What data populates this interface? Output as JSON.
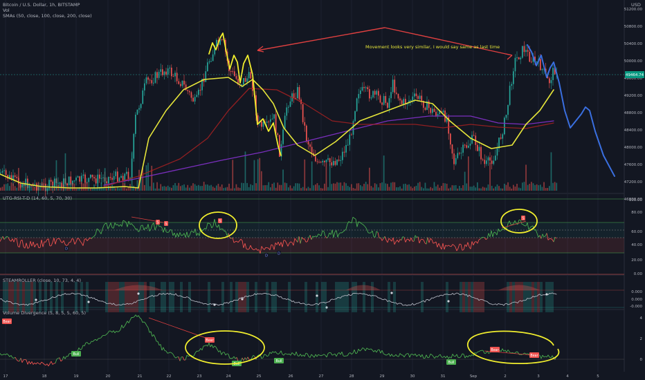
{
  "symbol_title": "Bitcoin / U.S. Dollar, 1h, BITSTAMP",
  "vol_label": "Vol",
  "sma_label": "SMAs (50, close, 100, close, 200, close)",
  "currency": "USD",
  "annotation": "Movement looks very similar, I would say same as last time",
  "price_badge": "49464.74",
  "price_axis": [
    "51200.00",
    "50800.00",
    "50400.00",
    "50000.00",
    "49600.00",
    "49200.00",
    "48800.00",
    "48400.00",
    "48000.00",
    "47600.00",
    "47200.00",
    "46800.00"
  ],
  "rsi": {
    "label": "UTG-RSI-T-D (14, 60, 5, 70, 30)",
    "axis": [
      "100.00",
      "80.00",
      "60.00",
      "40.00",
      "20.00",
      "0.00"
    ],
    "markers": [
      "S",
      "S",
      "S",
      "D",
      "D",
      "D",
      "S"
    ]
  },
  "steam": {
    "label": "STEAMROLLER (close, 10, 73, 4, 4)",
    "axis": [
      "0.000",
      "0.000",
      "-0.000"
    ]
  },
  "vdiv": {
    "label": "Volume Divergence (5, 8, 5, 5, 60, 5)",
    "axis": [
      "4",
      "2",
      "0"
    ],
    "bull_label": "Bull",
    "bear_label": "Bear"
  },
  "time_axis": [
    "17",
    "18",
    "19",
    "20",
    "21",
    "22",
    "23",
    "24",
    "25",
    "26",
    "27",
    "28",
    "29",
    "30",
    "31",
    "Sep",
    "2",
    "3",
    "4",
    "5"
  ],
  "colors": {
    "bg": "#131722",
    "up": "#26a69a",
    "down": "#ef5350",
    "sma50": "#e6e63a",
    "sma100": "#b22222",
    "sma200": "#7b2fbf",
    "projection": "#3a6fe0",
    "highlight": "#f2ef2e",
    "arrow": "#e04040"
  }
}
